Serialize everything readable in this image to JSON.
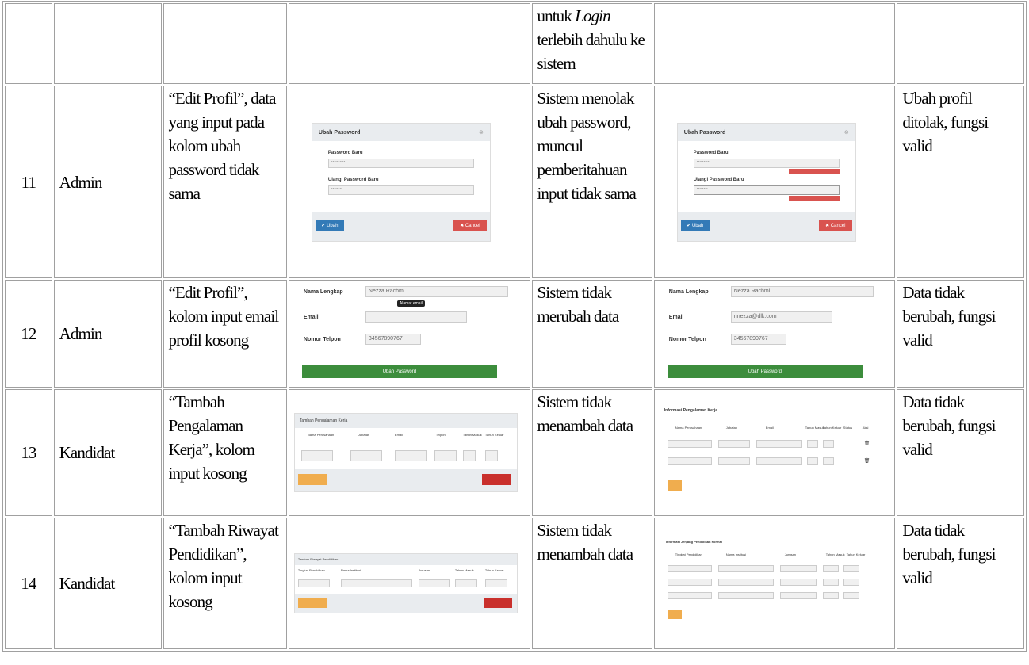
{
  "rows": [
    {
      "no": "",
      "actor": "",
      "scenario": "",
      "expected_parts": [
        "untuk ",
        "Login",
        " terlebih dahulu ke sistem"
      ],
      "result": ""
    },
    {
      "no": "11",
      "actor": "Admin",
      "scenario": "“Edit Profil”, data yang input pada kolom ubah password tidak sama",
      "expected": "Sistem menolak ubah password, muncul pemberitahuan input tidak sama",
      "result": "Ubah profil ditolak, fungsi valid",
      "mock_before": {
        "title": "Ubah Password",
        "label1": "Password Baru",
        "value1": "••••••••••",
        "label2": "Ulangi Password Baru",
        "value2": "••••••••",
        "ok": "Ubah",
        "cancel": "Cancel"
      },
      "mock_after": {
        "title": "Ubah Password",
        "label1": "Password Baru",
        "value1": "••••••••••",
        "label2": "Ulangi Password Baru",
        "value2": "••••••••",
        "ok": "Ubah",
        "cancel": "Cancel"
      }
    },
    {
      "no": "12",
      "actor": "Admin",
      "scenario": "“Edit Profil”, kolom input email profil kosong",
      "expected": "Sistem tidak merubah data",
      "result": "Data tidak berubah, fungsi valid",
      "mock_before": {
        "name_label": "Nama Lengkap",
        "name_value": "Nezza Rachmi",
        "tooltip": "Alamat email",
        "email_label": "Email",
        "phone_label": "Nomor Telpon",
        "phone_value": "34567890767",
        "button": "Ubah Password"
      },
      "mock_after": {
        "name_label": "Nama Lengkap",
        "name_value": "Nezza Rachmi",
        "email_label": "Email",
        "email_value": "nnezza@dlk.com",
        "phone_label": "Nomor Telpon",
        "phone_value": "34567890767",
        "button": "Ubah Password"
      }
    },
    {
      "no": "13",
      "actor": "Kandidat",
      "scenario": "“Tambah Pengalaman Kerja”, kolom input kosong",
      "expected": "Sistem tidak menambah data",
      "result": "Data tidak berubah, fungsi valid",
      "mock_before": {
        "title": "Tambah Pengalaman Kerja",
        "cols": [
          "Nama Perusahaan",
          "Jabatan",
          "Email",
          "Telpon",
          "Tahun Masuk",
          "Tahun Keluar"
        ]
      },
      "mock_after": {
        "title": "Informasi Pengalaman Kerja",
        "cols": [
          "Nama Perusahaan",
          "Jabatan",
          "Email",
          "Tahun Masuk",
          "Tahun Keluar",
          "Status",
          "Aksi"
        ]
      }
    },
    {
      "no": "14",
      "actor": "Kandidat",
      "scenario": "“Tambah Riwayat Pendidikan”, kolom input kosong",
      "expected": "Sistem tidak menambah data",
      "result": "Data tidak berubah, fungsi valid",
      "mock_before": {
        "title": "Tambah Riwayat Pendidikan",
        "cols": [
          "Tingkat Pendidikan",
          "Nama Institusi",
          "Jurusan",
          "Tahun Masuk",
          "Tahun Keluar"
        ]
      },
      "mock_after": {
        "title": "Informasi Jenjang Pendidikan Formal",
        "cols": [
          "Tingkat Pendidikan",
          "Nama Institusi",
          "Jurusan",
          "Tahun Masuk",
          "Tahun Keluar"
        ]
      }
    }
  ]
}
